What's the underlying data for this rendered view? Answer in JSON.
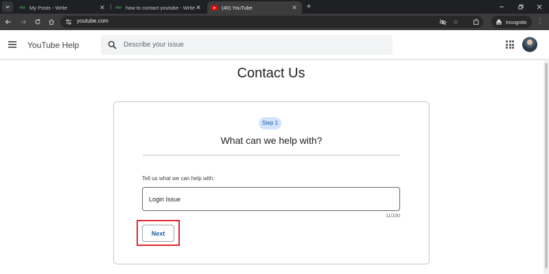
{
  "browser": {
    "tabs": [
      {
        "title": "My Posts - Write",
        "favicon": "gfg-icon",
        "active": false
      },
      {
        "title": "how to contact youtube - Write",
        "favicon": "gfg-icon",
        "active": false
      },
      {
        "title": "(40) YouTube",
        "favicon": "youtube-icon",
        "active": true
      }
    ],
    "url": "youtube.com",
    "incognito_label": "Incognito",
    "colors": {
      "chrome_dark": "#1f2023",
      "toolbar": "#3c3c3c",
      "gfg_green": "#2f8d46",
      "youtube_red": "#ff0000"
    }
  },
  "header": {
    "app_title": "YouTube Help",
    "search_placeholder": "Describe your issue"
  },
  "main": {
    "page_title": "Contact Us",
    "step_badge": "Step 1",
    "step_heading": "What can we help with?",
    "field_label": "Tell us what we can help with:",
    "field_value": "Login Issue",
    "char_count": "11/100",
    "next_label": "Next",
    "accent_color": "#1a5c9e",
    "highlight_color": "#e0242b"
  }
}
